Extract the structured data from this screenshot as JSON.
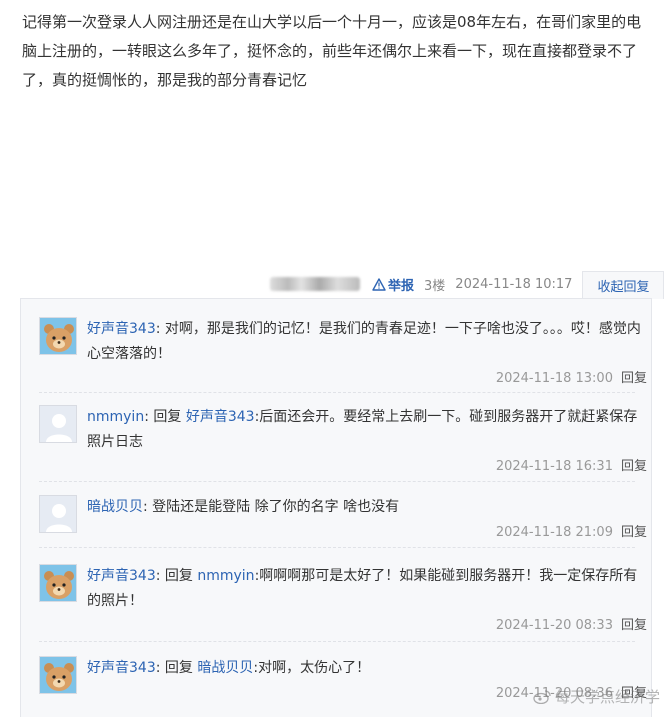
{
  "post": {
    "body": "记得第一次登录人人网注册还是在山大学以后一个十月一，应该是08年左右，在哥们家里的电脑上注册的，一转眼这么多年了，挺怀念的，前些年还偶尔上来看一下，现在直接都登录不了了，真的挺惆怅的，那是我的部分青春记忆"
  },
  "meta": {
    "report_label": "举报",
    "floor": "3楼",
    "time": "2024-11-18 10:17",
    "collapse_label": "收起回复"
  },
  "replies": [
    {
      "user": "好声音343",
      "prefix": "",
      "target": "",
      "content": "对啊，那是我们的记忆！是我们的青春足迹！一下子啥也没了。。。哎！感觉内心空落落的！",
      "time": "2024-11-18 13:00",
      "reply_label": "回复",
      "avatar": "bear"
    },
    {
      "user": "nmmyin",
      "prefix": "回复",
      "target": "好声音343",
      "content": ":后面还会开。要经常上去刷一下。碰到服务器开了就赶紧保存照片日志",
      "time": "2024-11-18 16:31",
      "reply_label": "回复",
      "avatar": "default"
    },
    {
      "user": "暗战贝贝",
      "prefix": "",
      "target": "",
      "content": "登陆还是能登陆 除了你的名字 啥也没有",
      "time": "2024-11-18 21:09",
      "reply_label": "回复",
      "avatar": "default"
    },
    {
      "user": "好声音343",
      "prefix": "回复",
      "target": "nmmyin",
      "content": ":啊啊啊那可是太好了！如果能碰到服务器开！我一定保存所有的照片！",
      "time": "2024-11-20 08:33",
      "reply_label": "回复",
      "avatar": "bear"
    },
    {
      "user": "好声音343",
      "prefix": "回复",
      "target": "暗战贝贝",
      "content": ":对啊，太伤心了！",
      "time": "2024-11-20 08:36",
      "reply_label": "回复",
      "avatar": "bear"
    }
  ],
  "watermark": "每天学点经济学",
  "colors": {
    "link": "#2d64b3",
    "panel": "#f7f8fa",
    "border": "#e4e6eb",
    "muted": "#999999"
  }
}
